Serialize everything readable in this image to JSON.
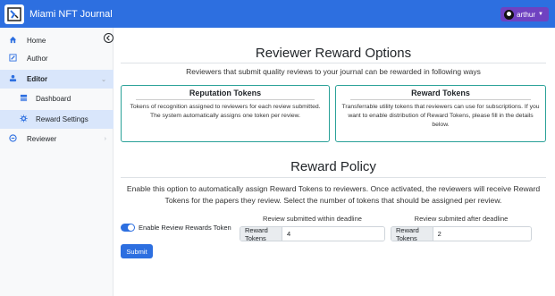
{
  "app": {
    "title": "Miami NFT Journal"
  },
  "user": {
    "name": "arthur"
  },
  "sidebar": {
    "items": [
      {
        "label": "Home",
        "icon": "home-icon"
      },
      {
        "label": "Author",
        "icon": "pen-icon"
      },
      {
        "label": "Editor",
        "icon": "editor-icon"
      },
      {
        "label": "Dashboard",
        "icon": "dashboard-icon"
      },
      {
        "label": "Reward Settings",
        "icon": "gear-icon"
      },
      {
        "label": "Reviewer",
        "icon": "reviewer-icon"
      }
    ]
  },
  "page": {
    "title": "Reviewer Reward Options",
    "description": "Reviewers that submit quality reviews to your journal can be rewarded in following ways",
    "reputation": {
      "title": "Reputation Tokens",
      "body": "Tokens of recognition assigned to reviewers for each review submitted. The system automatically assigns one token per review."
    },
    "reward": {
      "title": "Reward Tokens",
      "body": "Transferrable utility tokens that reviewers can use for subscriptions. If you want to enable distribution of Reward Tokens, please fill in the details below."
    }
  },
  "policy": {
    "title": "Reward Policy",
    "description": "Enable this option to automatically assign Reward Tokens to reviewers. Once activated, the reviewers will receive Reward Tokens for the papers they review. Select the number of tokens that should be assigned per review.",
    "toggle_label": "Enable Review Rewards Token",
    "within": {
      "header": "Review submitted within deadline",
      "addon": "Reward Tokens",
      "value": "4"
    },
    "after": {
      "header": "Review submited after deadline",
      "addon": "Reward Tokens",
      "value": "2"
    },
    "submit_label": "Submit"
  },
  "colors": {
    "primary": "#2d6fe0",
    "accent": "#2aa198",
    "user_btn": "#6f42c1"
  }
}
